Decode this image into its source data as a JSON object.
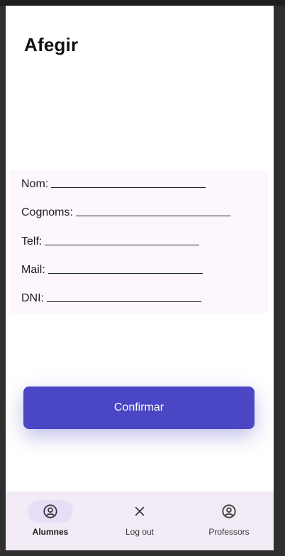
{
  "page": {
    "title": "Afegir"
  },
  "form": {
    "fields": [
      {
        "label": "Nom:"
      },
      {
        "label": "Cognoms:"
      },
      {
        "label": "Telf:"
      },
      {
        "label": "Mail:"
      },
      {
        "label": "DNI:"
      }
    ]
  },
  "actions": {
    "confirm_label": "Confirmar"
  },
  "bottom_nav": {
    "items": [
      {
        "label": "Alumnes",
        "icon": "account-circle-icon",
        "active": true
      },
      {
        "label": "Log out",
        "icon": "close-icon",
        "active": false
      },
      {
        "label": "Professors",
        "icon": "account-circle-icon",
        "active": false
      }
    ]
  },
  "colors": {
    "accent": "#4a46c4",
    "form_background": "#fdf6fd",
    "nav_background": "#f2ebf6",
    "nav_active_pill": "#e8def8"
  }
}
